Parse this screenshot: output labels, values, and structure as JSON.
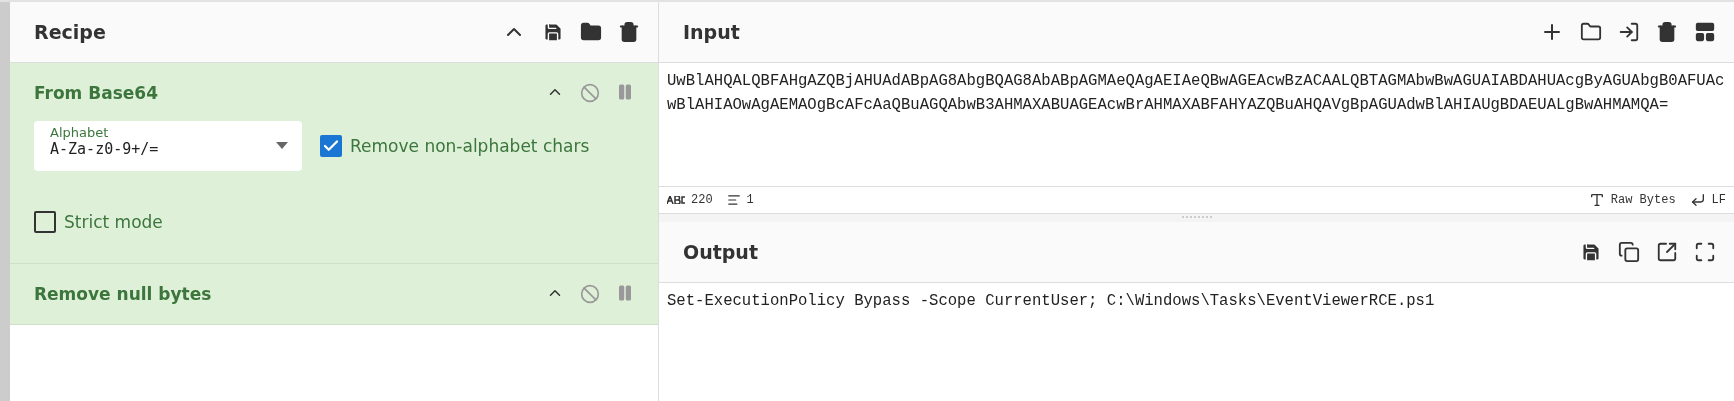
{
  "recipe": {
    "title": "Recipe",
    "operations": [
      {
        "title": "From Base64",
        "disabled": false,
        "paused": false,
        "args": [
          {
            "kind": "dropdown",
            "label": "Alphabet",
            "value": "A-Za-z0-9+/="
          },
          {
            "kind": "checkbox",
            "label": "Remove non-alphabet chars",
            "checked": true
          },
          {
            "kind": "checkbox",
            "label": "Strict mode",
            "checked": false
          }
        ]
      },
      {
        "title": "Remove null bytes",
        "disabled": false,
        "paused": false
      }
    ]
  },
  "input": {
    "title": "Input",
    "value": "UwBlAHQALQBFAHgAZQBjAHUAdABpAG8AbgBQAG8AbABpAGMAeQAgAEIAeQBwAGEAcwBzACAALQBTAGMAbwBwAGUAIABDAHUAcgByAGUAbgB0AFUAcwBlAHIAOwAgAEMAOgBcAFcAaQBuAGQAbwB3AHMAXABUAGEAcwBrAHMAXABFAHYAZQBuAHQAVgBpAGUAdwBlAHIAUgBDAEUALgBwAHMAMQA=",
    "status": {
      "length": "220",
      "lines": "1",
      "encoding": "Raw Bytes",
      "eol": "LF"
    }
  },
  "output": {
    "title": "Output",
    "value": "Set-ExecutionPolicy Bypass -Scope CurrentUser; C:\\Windows\\Tasks\\EventViewerRCE.ps1"
  }
}
